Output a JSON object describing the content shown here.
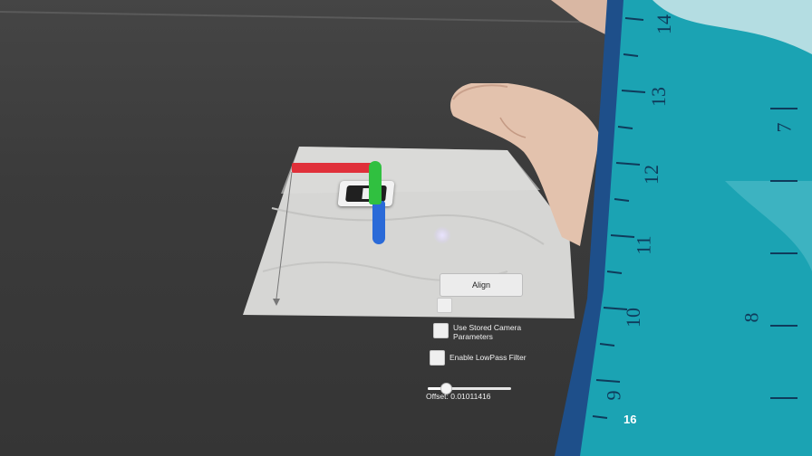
{
  "ui": {
    "align_label": "Align",
    "checkbox_hidden_label": "",
    "stored_camera_label_line1": "Use Stored Camera",
    "stored_camera_label_line2": "Parameters",
    "lowpass_label": "Enable LowPass Filter",
    "offset_label": "Offset: 0.01011416",
    "offset_value": 0.01011416,
    "slider_fraction": 0.22,
    "fps_counter": "16"
  },
  "ruler": {
    "numbers": [
      "14",
      "13",
      "12",
      "11",
      "10",
      "9",
      "7",
      "8"
    ]
  },
  "colors": {
    "axis_x": "#e0303a",
    "axis_y": "#30c040",
    "axis_z": "#2a6ad8",
    "ruler_fill": "#1ba3b3",
    "ruler_frame": "#1e4f8a"
  }
}
